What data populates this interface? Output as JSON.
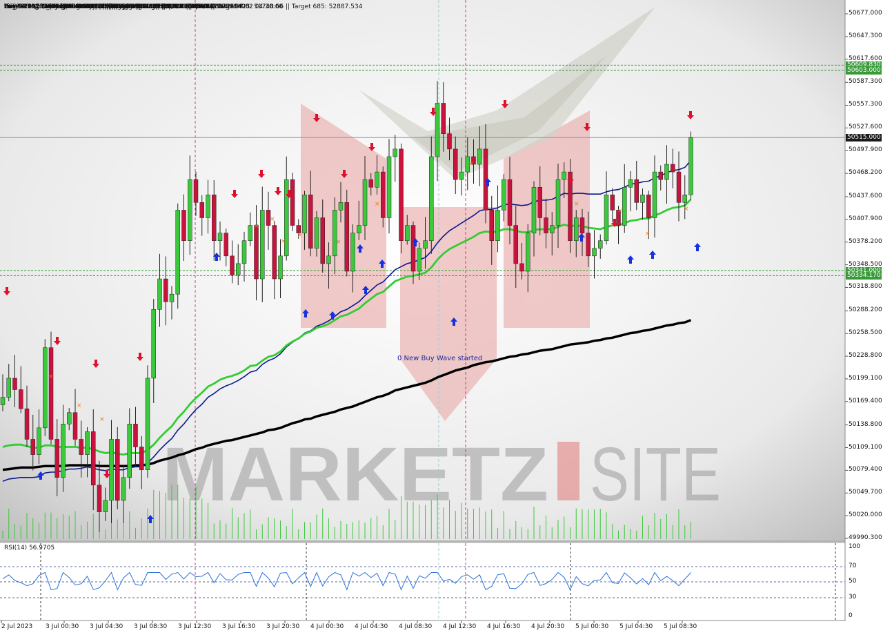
{
  "header": {
    "lines": [
      "USDTIRT-Nbi,M30  50430.000 50515.000 50420.000 50515.000",
      "Line:2375 | Last Signal is:Buy with stoploss:49347.59",
      "Point A:49733 | Point B:50168 | Point C:49906",
      "Time A:2023.07.01 08:00:00 | Time B:2023.07.01 14:30:00 | Time C:2023.07.02 04:30:00",
      "Buy %20 @ Market price or at: 49941 || Target:52887.534 || R/R:4.96542694",
      "Buy %20 @ Correction Entry38: 50001.83 || Target:51748.66 | R/R:2.67001406",
      "Buy %10 @ C_Entry61: 49899.17 || Target:51044.83 | R/R:2.07705138",
      "Buy %10 @ C_Entry88: 49787.375 || Target:50603 | R/R:1.85459941",
      "Buy %20 @ Entry -23: 49630.34 || Target:50341 || R/R:2.5133863B",
      "Buy %20 @ Entry -50: 49515.5 || Target:50334.17 || R/R:4.87564767",
      "Target100: 50341 || Target 161: 50609.83 || Target 261: 51044.83 || Target 423: 51748.66 || Target 685: 52887.534"
    ]
  },
  "annotation": "0 New Buy Wave started",
  "watermark": "MARKETZ SITE",
  "price_tags": [
    {
      "label": "50609.830",
      "value": 50609.83,
      "color": "#3a9a3a"
    },
    {
      "label": "50603.000",
      "value": 50603.0,
      "color": "#3a9a3a"
    },
    {
      "label": "50515.000",
      "value": 50515.0,
      "color": "#1a1a1a"
    },
    {
      "label": "50341.000",
      "value": 50341.0,
      "color": "#3a9a3a"
    },
    {
      "label": "50334.170",
      "value": 50334.17,
      "color": "#3a9a3a"
    }
  ],
  "rsi": {
    "label": "RSI(14) 56.9705",
    "levels": [
      "100",
      "70",
      "50",
      "30",
      "0"
    ],
    "color": "#2a6fd6"
  },
  "colors": {
    "bull": "#3cc83c",
    "bear": "#c8143c",
    "ma_fast": "#33cc33",
    "ma_mid": "#0a1a8c",
    "ma_slow": "#000000",
    "level_line": "#2e9a2e",
    "vline": "#c83c8c"
  },
  "chart_data": {
    "type": "candlestick",
    "symbol": "USDTIRT-Nbi",
    "timeframe": "M30",
    "ylim": [
      49990.3,
      50677.0
    ],
    "y_ticks": [
      50677.0,
      50647.3,
      50617.6,
      50587.3,
      50557.3,
      50527.6,
      50497.9,
      50468.2,
      50437.6,
      50407.9,
      50378.2,
      50348.5,
      50318.8,
      50288.2,
      50258.5,
      50228.8,
      50199.1,
      50169.4,
      50138.8,
      50109.1,
      50079.4,
      50049.7,
      50020.0,
      49990.3
    ],
    "y_tick_labels": [
      "50677.000",
      "50647.300",
      "50617.600",
      "50587.300",
      "50557.300",
      "50527.600",
      "50497.900",
      "50468.200",
      "50437.600",
      "50407.900",
      "50378.200",
      "50348.500",
      "50318.800",
      "50288.200",
      "50258.500",
      "50228.800",
      "50199.100",
      "50169.400",
      "50138.800",
      "50109.100",
      "50079.400",
      "50049.700",
      "50020.000",
      "49990.300"
    ],
    "x_labels": [
      "2 Jul 2023",
      "3 Jul 00:30",
      "3 Jul 04:30",
      "3 Jul 08:30",
      "3 Jul 12:30",
      "3 Jul 16:30",
      "3 Jul 20:30",
      "4 Jul 00:30",
      "4 Jul 04:30",
      "4 Jul 08:30",
      "4 Jul 12:30",
      "4 Jul 16:30",
      "4 Jul 20:30",
      "5 Jul 00:30",
      "5 Jul 04:30",
      "5 Jul 08:30"
    ],
    "last": {
      "open": 50430.0,
      "high": 50515.0,
      "low": 50420.0,
      "close": 50515.0
    },
    "level_lines": [
      50609.83,
      50603.0,
      50341.0,
      50334.17
    ],
    "current_price": 50515.0,
    "close": [
      50175,
      50200,
      50185,
      50160,
      50120,
      50100,
      50135,
      50240,
      50120,
      50070,
      50140,
      50155,
      50120,
      50100,
      50130,
      50060,
      50025,
      50040,
      50120,
      50040,
      50070,
      50140,
      50110,
      50080,
      50200,
      50290,
      50330,
      50300,
      50310,
      50420,
      50380,
      50460,
      50430,
      50410,
      50440,
      50380,
      50390,
      50360,
      50335,
      50350,
      50380,
      50400,
      50330,
      50420,
      50400,
      50330,
      50360,
      50460,
      50400,
      50390,
      50440,
      50370,
      50410,
      50350,
      50360,
      50420,
      50430,
      50340,
      50390,
      50400,
      50460,
      50450,
      50470,
      50410,
      50490,
      50500,
      50380,
      50400,
      50340,
      50370,
      50380,
      50490,
      50560,
      50520,
      50500,
      50460,
      50470,
      50490,
      50480,
      50500,
      50420,
      50380,
      50420,
      50460,
      50400,
      50350,
      50340,
      50390,
      50450,
      50410,
      50390,
      50400,
      50460,
      50470,
      50380,
      50410,
      50390,
      50360,
      50370,
      50380,
      50440,
      50420,
      50400,
      50450,
      50460,
      50430,
      50440,
      50410,
      50470,
      50460,
      50480,
      50470,
      50430,
      50440,
      50515
    ],
    "ma_fast": [
      50110,
      50112,
      50113,
      50113,
      50111,
      50109,
      50109,
      50112,
      50112,
      50110,
      50110,
      50110,
      50110,
      50109,
      50109,
      50107,
      50104,
      50102,
      50103,
      50101,
      50100,
      50102,
      50102,
      50102,
      50106,
      50113,
      50122,
      50130,
      50137,
      50148,
      50156,
      50166,
      50174,
      50181,
      50189,
      50193,
      50198,
      50201,
      50203,
      50206,
      50210,
      50216,
      50217,
      50223,
      50228,
      50230,
      50235,
      50243,
      50248,
      50252,
      50258,
      50261,
      50266,
      50268,
      50271,
      50276,
      50281,
      50283,
      50287,
      50291,
      50298,
      50304,
      50310,
      50313,
      50320,
      50327,
      50330,
      50333,
      50334,
      50336,
      50338,
      50345,
      50355,
      50363,
      50369,
      50373,
      50377,
      50381,
      50385,
      50390,
      50392,
      50391,
      50392,
      50395,
      50395,
      50393,
      50391,
      50391,
      50394,
      50395,
      50395,
      50395,
      50398,
      50401,
      50399,
      50400,
      50399,
      50397,
      50396,
      50395,
      50398,
      50400,
      50400,
      50403,
      50406,
      50407,
      50409,
      50409,
      50413,
      50416,
      50420,
      50423,
      50424,
      50426,
      50434
    ],
    "ma_mid": [
      50065,
      50068,
      50069,
      50070,
      50070,
      50070,
      50071,
      50076,
      50077,
      50077,
      50079,
      50081,
      50081,
      50082,
      50084,
      50082,
      50080,
      50079,
      50081,
      50080,
      50080,
      50083,
      50084,
      50084,
      50089,
      50097,
      50106,
      50114,
      50121,
      50132,
      50140,
      50150,
      50159,
      50166,
      50175,
      50180,
      50186,
      50190,
      50193,
      50197,
      50202,
      50208,
      50210,
      50218,
      50223,
      50226,
      50232,
      50241,
      50247,
      50252,
      50259,
      50262,
      50268,
      50271,
      50275,
      50281,
      50287,
      50290,
      50295,
      50300,
      50308,
      50315,
      50322,
      50326,
      50334,
      50342,
      50346,
      50350,
      50352,
      50355,
      50358,
      50366,
      50377,
      50386,
      50393,
      50398,
      50403,
      50408,
      50413,
      50419,
      50421,
      50421,
      50423,
      50427,
      50428,
      50427,
      50426,
      50427,
      50431,
      50433,
      50433,
      50434,
      50438,
      50442,
      50441,
      50442,
      50442,
      50441,
      50441,
      50441,
      50444,
      50446,
      50447,
      50450,
      50454,
      50455,
      50457,
      50458,
      50462,
      50465,
      50469,
      50472,
      50473,
      50476,
      50485
    ],
    "ma_slow": [
      50080,
      50081,
      50082,
      50083,
      50083,
      50083,
      50084,
      50085,
      50085,
      50085,
      50085,
      50086,
      50086,
      50086,
      50086,
      50086,
      50085,
      50085,
      50085,
      50085,
      50085,
      50085,
      50086,
      50086,
      50087,
      50089,
      50092,
      50094,
      50096,
      50099,
      50101,
      50104,
      50107,
      50109,
      50112,
      50114,
      50116,
      50118,
      50119,
      50121,
      50123,
      50125,
      50127,
      50129,
      50132,
      50133,
      50135,
      50138,
      50141,
      50143,
      50146,
      50147,
      50150,
      50152,
      50154,
      50156,
      50159,
      50161,
      50163,
      50166,
      50169,
      50172,
      50175,
      50177,
      50180,
      50184,
      50186,
      50188,
      50190,
      50192,
      50194,
      50197,
      50201,
      50204,
      50207,
      50210,
      50212,
      50214,
      50217,
      50219,
      50221,
      50222,
      50224,
      50226,
      50228,
      50229,
      50231,
      50232,
      50234,
      50236,
      50237,
      50238,
      50240,
      50242,
      50244,
      50245,
      50246,
      50247,
      50249,
      50250,
      50252,
      50253,
      50255,
      50257,
      50259,
      50260,
      50262,
      50263,
      50265,
      50267,
      50269,
      50270,
      50272,
      50273,
      50276
    ]
  }
}
